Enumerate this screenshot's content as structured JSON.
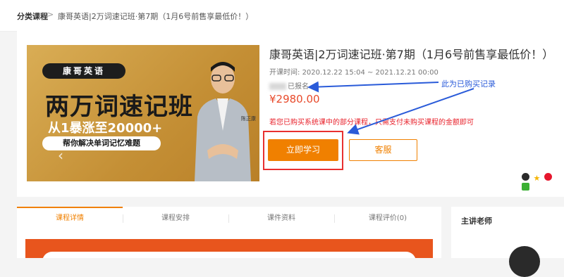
{
  "breadcrumb": {
    "root": "分类课程",
    "separator": ">",
    "current": "康哥英语|2万词速记班·第7期（1月6号前售享最低价！）"
  },
  "banner": {
    "brand": "康哥英语",
    "title": "两万词速记班",
    "subtitle": "从1暴涨至20000+",
    "tagline": "帮你解决单词记忆难题",
    "teacher_name": "陈正康"
  },
  "course": {
    "title": "康哥英语|2万词速记班·第7期（1月6号前售享最低价！）",
    "time_label": "开课时间:",
    "time_value": "2020.12.22 15:04 ~ 2021.12.21 00:00",
    "registered": "已报名",
    "price": "¥2980.00",
    "notice": "若您已购买系统课中的部分课程，只需支付未购买课程的金额即可"
  },
  "annotation": {
    "text": "此为已购买记录"
  },
  "buttons": {
    "study": "立即学习",
    "service": "客服"
  },
  "tabs": [
    {
      "label": "课程详情"
    },
    {
      "label": "课程安排"
    },
    {
      "label": "课件资料"
    },
    {
      "label": "课程评价(0)"
    }
  ],
  "sidebar": {
    "title": "主讲老师"
  },
  "colors": {
    "accent": "#f08000",
    "price": "#e84a2b",
    "notice": "#e8202a",
    "annotation": "#2a5bd9",
    "highlight_box": "#e83030"
  },
  "share_icons": [
    "qq-icon",
    "star-icon",
    "weibo-icon",
    "wechat-icon"
  ]
}
